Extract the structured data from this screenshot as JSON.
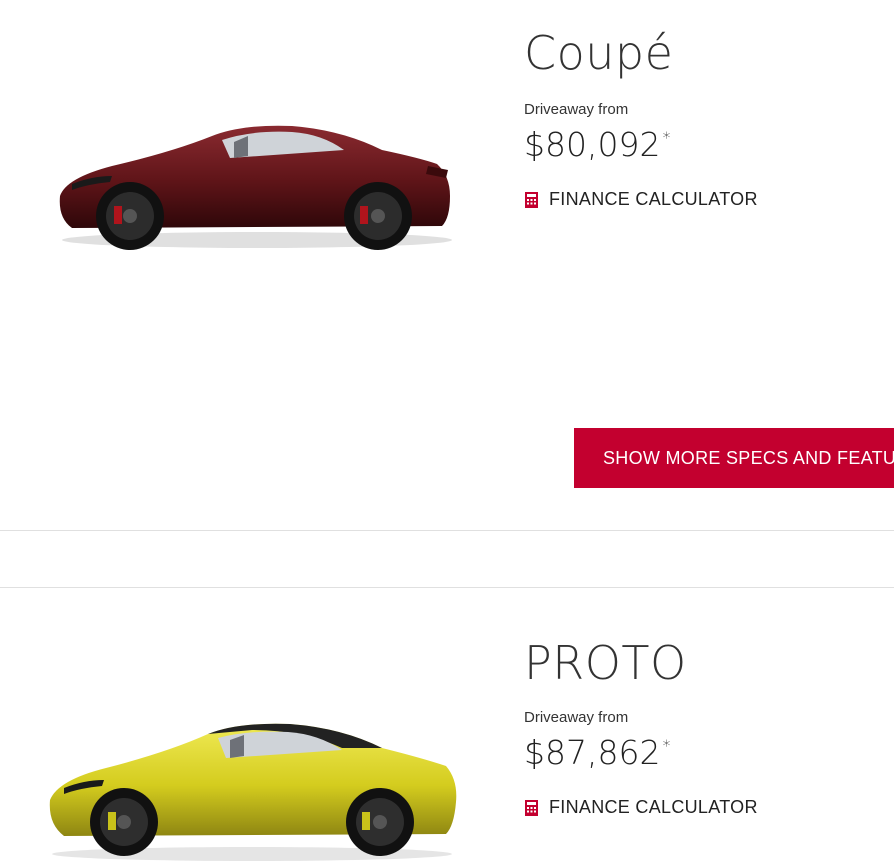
{
  "variants": [
    {
      "name": "Coupé",
      "driveaway_label": "Driveaway from",
      "price": "$80,092",
      "price_mark": "*",
      "finance_label": "FINANCE CALCULATOR",
      "car_color": "#5e1418"
    },
    {
      "name": "PROTO",
      "driveaway_label": "Driveaway from",
      "price": "$87,862",
      "price_mark": "*",
      "finance_label": "FINANCE CALCULATOR",
      "car_color": "#d4cc1e"
    }
  ],
  "cta": {
    "label": "SHOW MORE SPECS AND FEATURES"
  },
  "colors": {
    "accent": "#c3002f",
    "divider": "#e0e0e0"
  },
  "icons": {
    "finance": "calculator-icon"
  }
}
